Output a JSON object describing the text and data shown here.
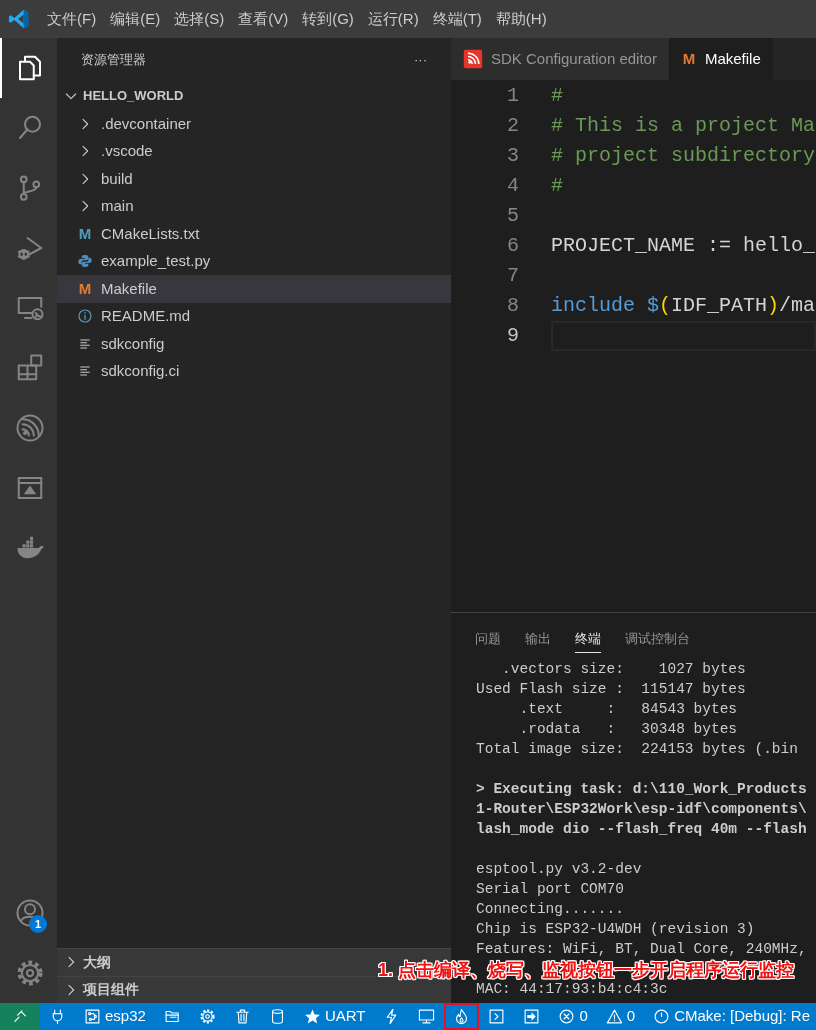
{
  "menu": [
    "文件(F)",
    "编辑(E)",
    "选择(S)",
    "查看(V)",
    "转到(G)",
    "运行(R)",
    "终端(T)",
    "帮助(H)"
  ],
  "activity_bar": [
    {
      "kind": "files",
      "selected": true
    },
    {
      "kind": "search",
      "selected": false
    },
    {
      "kind": "scm",
      "selected": false
    },
    {
      "kind": "debug",
      "selected": false
    },
    {
      "kind": "remote",
      "selected": false
    },
    {
      "kind": "extensions",
      "selected": false
    },
    {
      "kind": "esp",
      "selected": false
    },
    {
      "kind": "idf",
      "selected": false
    },
    {
      "kind": "docker",
      "selected": false
    }
  ],
  "activity_bottom": [
    {
      "kind": "account",
      "badge": "1"
    },
    {
      "kind": "gear"
    }
  ],
  "sidebar": {
    "title": "资源管理器",
    "more": "···",
    "root": {
      "label": "HELLO_WORLD",
      "expanded": true,
      "children": [
        {
          "label": ".devcontainer",
          "kind": "folder",
          "expanded": false,
          "selected": false
        },
        {
          "label": ".vscode",
          "kind": "folder",
          "expanded": false,
          "selected": false
        },
        {
          "label": "build",
          "kind": "folder",
          "expanded": false,
          "selected": false
        },
        {
          "label": "main",
          "kind": "folder",
          "expanded": false,
          "selected": false
        },
        {
          "label": "CMakeLists.txt",
          "kind": "letter",
          "icon_text": "M",
          "color": "#519aba",
          "selected": false
        },
        {
          "label": "example_test.py",
          "kind": "python",
          "selected": false
        },
        {
          "label": "Makefile",
          "kind": "letter",
          "icon_text": "M",
          "color": "#e37933",
          "selected": true
        },
        {
          "label": "README.md",
          "kind": "info",
          "selected": false
        },
        {
          "label": "sdkconfig",
          "kind": "text",
          "selected": false
        },
        {
          "label": "sdkconfig.ci",
          "kind": "text",
          "selected": false
        }
      ]
    },
    "sections": [
      {
        "label": "大纲",
        "expanded": false
      },
      {
        "label": "项目组件",
        "expanded": false
      }
    ]
  },
  "tabs": [
    {
      "label": "SDK Configuration editor",
      "kind": "esp",
      "selected": false
    },
    {
      "label": "Makefile",
      "kind": "letter",
      "icon_text": "M",
      "selected": true
    }
  ],
  "code": [
    {
      "number": "1",
      "tokens": [
        {
          "text": "#",
          "kind": "comment"
        }
      ]
    },
    {
      "number": "2",
      "tokens": [
        {
          "text": "# This is a project Ma",
          "kind": "comment"
        }
      ]
    },
    {
      "number": "3",
      "tokens": [
        {
          "text": "# project subdirectory",
          "kind": "comment"
        }
      ]
    },
    {
      "number": "4",
      "tokens": [
        {
          "text": "#",
          "kind": "comment"
        }
      ]
    },
    {
      "number": "5"
    },
    {
      "number": "6",
      "tokens": [
        {
          "text": "PROJECT_NAME := hello_",
          "kind": "plain"
        }
      ]
    },
    {
      "number": "7"
    },
    {
      "number": "8",
      "tokens": [
        {
          "text": "include",
          "kind": "keyword"
        },
        {
          "text": " $",
          "kind": "keyword"
        },
        {
          "text": "(",
          "kind": "bracket"
        },
        {
          "text": "IDF_PATH",
          "kind": "plain"
        },
        {
          "text": ")",
          "kind": "bracket"
        },
        {
          "text": "/ma",
          "kind": "plain"
        }
      ]
    },
    {
      "number": "9",
      "current": true
    }
  ],
  "panel": {
    "tabs": [
      {
        "label": "问题",
        "selected": false
      },
      {
        "label": "输出",
        "selected": false
      },
      {
        "label": "终端",
        "selected": true
      },
      {
        "label": "调试控制台",
        "selected": false
      }
    ],
    "terminal_blocks": [
      [
        {
          "text": "   .vectors size:    1027 bytes"
        },
        {
          "text": "Used Flash size :  115147 bytes"
        },
        {
          "text": "     .text     :   84543 bytes"
        },
        {
          "text": "     .rodata   :   30348 bytes"
        },
        {
          "text": "Total image size:  224153 bytes (.bin"
        }
      ],
      [
        {
          "text": "> Executing task: d:\\110_Work_Products",
          "kind": "command"
        },
        {
          "text": "1-Router\\ESP32Work\\esp-idf\\components\\",
          "kind": "command"
        },
        {
          "text": "lash_mode dio --flash_freq 40m --flash",
          "kind": "command"
        }
      ],
      [
        {
          "text": "esptool.py v3.2-dev"
        },
        {
          "text": "Serial port COM70"
        },
        {
          "text": "Connecting......."
        },
        {
          "text": "Chip is ESP32-U4WDH (revision 3)"
        },
        {
          "text": "Features: WiFi, BT, Dual Core, 240MHz,"
        }
      ],
      [
        {
          "text": "MAC: 44:17:93:b4:c4:3c"
        }
      ]
    ]
  },
  "status_bar": [
    {
      "kind": "remote"
    },
    {
      "kind": "plug"
    },
    {
      "kind": "board",
      "text": "esp32"
    },
    {
      "kind": "folder"
    },
    {
      "kind": "gear"
    },
    {
      "kind": "trash"
    },
    {
      "kind": "database"
    },
    {
      "kind": "star",
      "text": "UART"
    },
    {
      "kind": "bolt"
    },
    {
      "kind": "monitor"
    },
    {
      "kind": "flame",
      "highlighted": true
    },
    {
      "kind": "terminal"
    },
    {
      "kind": "upload"
    },
    {
      "kind": "errors",
      "text": "0"
    },
    {
      "kind": "warnings",
      "text": "0"
    },
    {
      "kind": "cmake",
      "text": "CMake: [Debug]: Re"
    }
  ],
  "annotation": {
    "text": "1. 点击编译、烧写、监视按钮一步开启程序运行监控"
  }
}
